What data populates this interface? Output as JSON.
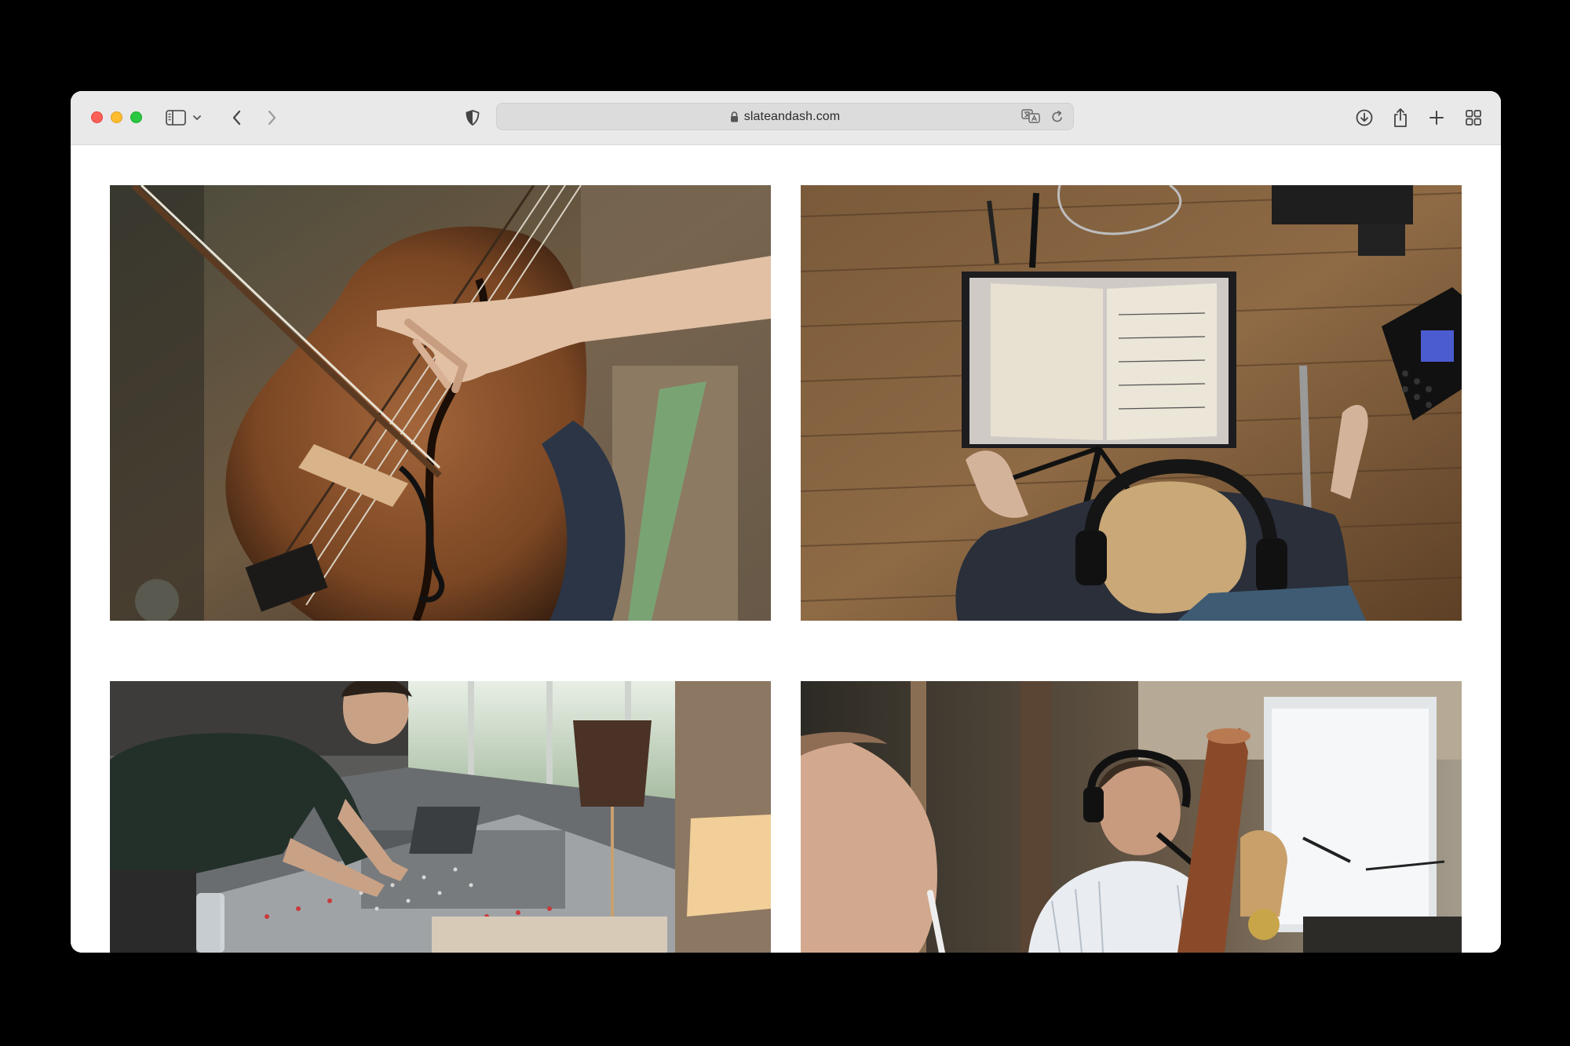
{
  "browser": {
    "url": "slateandash.com",
    "colors": {
      "close": "#fe5f57",
      "minimize": "#febc2e",
      "zoom": "#28c840",
      "toolbar": "#e9e9ea"
    },
    "icons": {
      "sidebar": "sidebar-icon",
      "tab_group_menu": "chevron-down-icon",
      "back": "chevron-left-icon",
      "forward": "chevron-right-icon",
      "privacy": "shield-icon",
      "secure": "lock-icon",
      "translate": "translate-icon",
      "reload": "reload-icon",
      "downloads": "download-icon",
      "share": "share-icon",
      "new_tab": "plus-icon",
      "tab_overview": "grid-icon"
    }
  },
  "gallery": {
    "photos": [
      {
        "subject": "cello-bow-strings"
      },
      {
        "subject": "music-stand-overhead-headphones"
      },
      {
        "subject": "engineer-at-mixing-console"
      },
      {
        "subject": "musicians-recording-headphones"
      }
    ]
  }
}
